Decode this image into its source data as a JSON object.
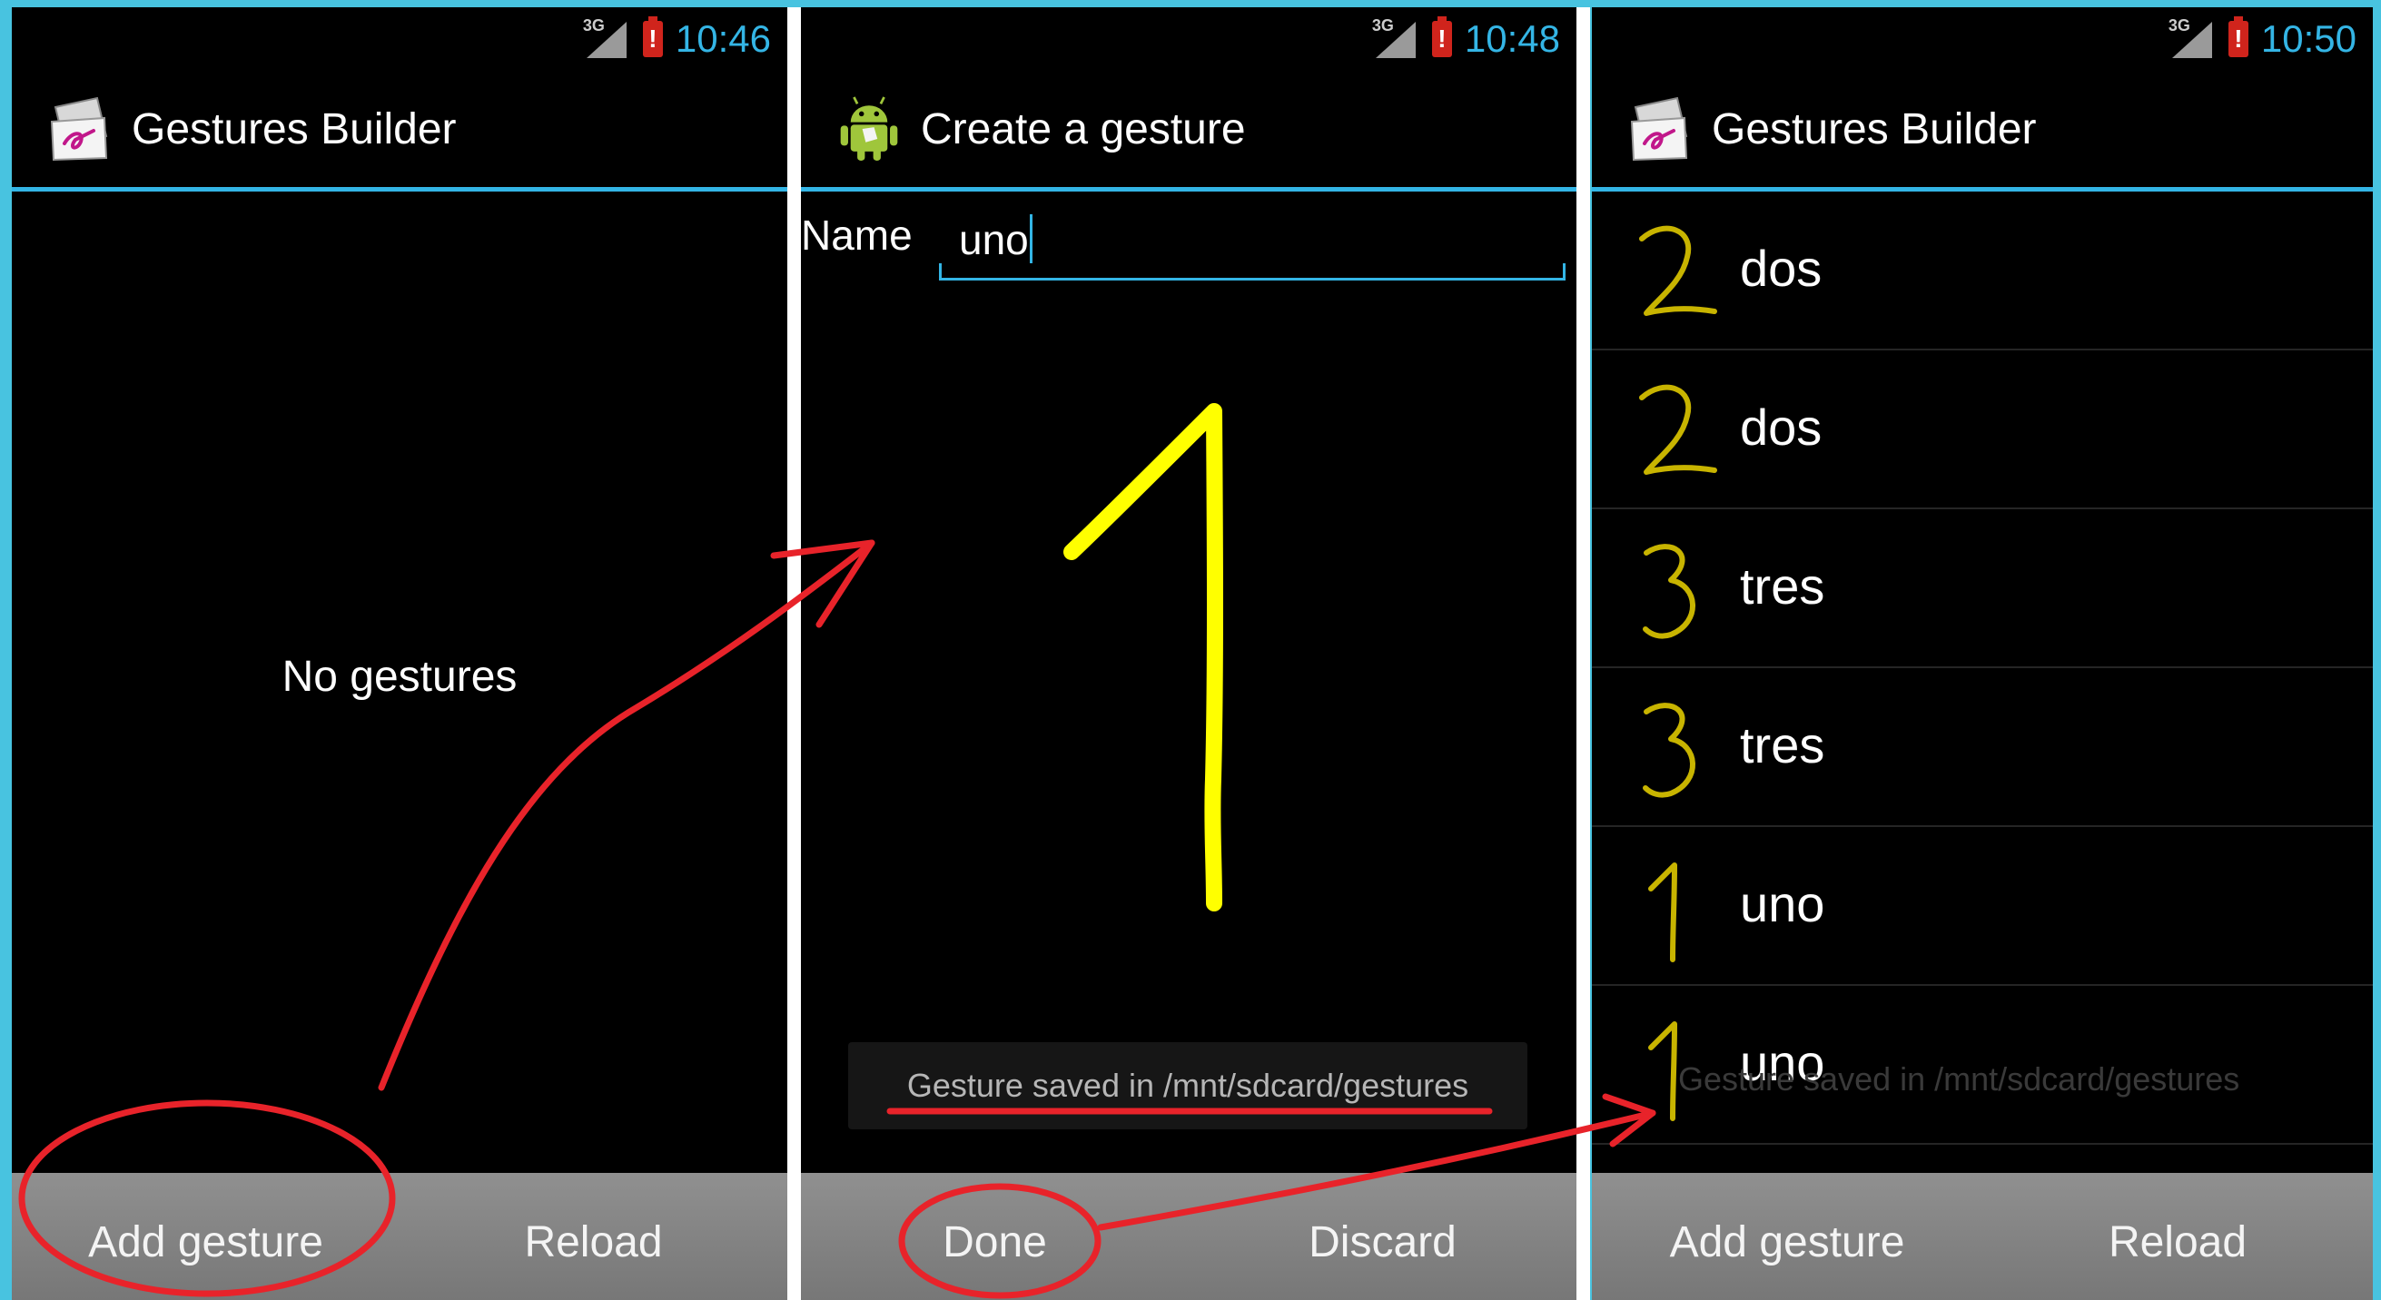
{
  "screens": [
    {
      "status": {
        "network": "3G",
        "time": "10:46"
      },
      "title": "Gestures Builder",
      "empty_text": "No gestures",
      "buttons": [
        "Add gesture",
        "Reload"
      ]
    },
    {
      "status": {
        "network": "3G",
        "time": "10:48"
      },
      "title": "Create a gesture",
      "name_label": "Name",
      "name_value": "uno",
      "toast": "Gesture saved in /mnt/sdcard/gestures",
      "buttons": [
        "Done",
        "Discard"
      ]
    },
    {
      "status": {
        "network": "3G",
        "time": "10:50"
      },
      "title": "Gestures Builder",
      "gestures": [
        {
          "label": "dos",
          "glyph": "two"
        },
        {
          "label": "dos",
          "glyph": "two"
        },
        {
          "label": "tres",
          "glyph": "three"
        },
        {
          "label": "tres",
          "glyph": "three"
        },
        {
          "label": "uno",
          "glyph": "one"
        },
        {
          "label": "uno",
          "glyph": "one"
        }
      ],
      "toast_faded": "Gesture saved in /mnt/sdcard/gestures",
      "buttons": [
        "Add gesture",
        "Reload"
      ]
    }
  ],
  "colors": {
    "background": "#48c3e0",
    "accent": "#33b5e5",
    "gesture_stroke": "#ffff00",
    "thumbnail_stroke": "#c8b400",
    "annotation": "#e8232a"
  }
}
